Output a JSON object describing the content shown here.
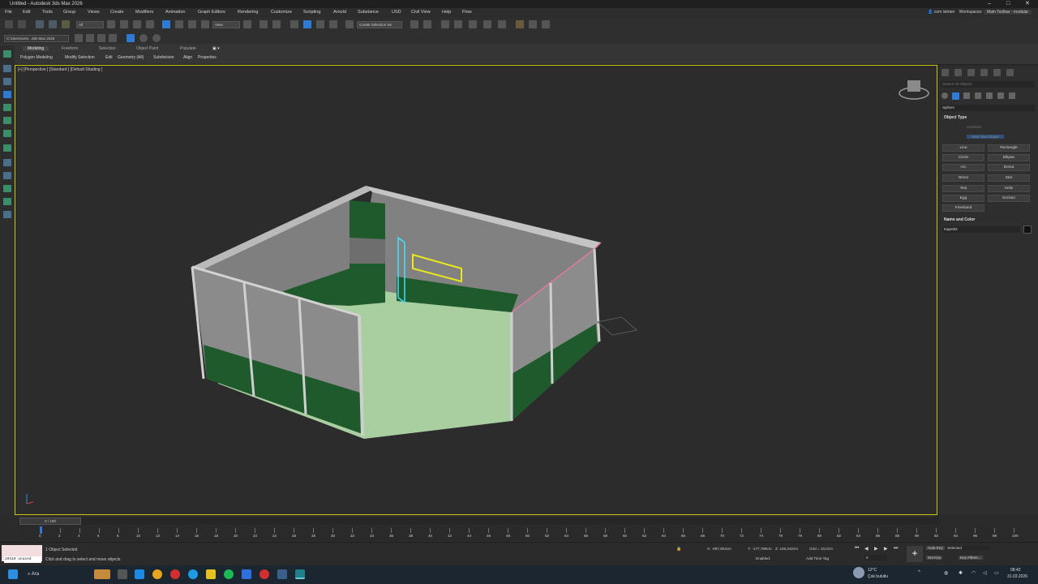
{
  "window": {
    "title": "Untitled - Autodesk 3ds Max 2026",
    "min": "–",
    "max": "□",
    "close": "✕"
  },
  "menu": [
    "File",
    "Edit",
    "Tools",
    "Group",
    "Views",
    "Create",
    "Modifiers",
    "Animation",
    "Graph Editors",
    "Rendering",
    "Customize",
    "Scripting",
    "Arnold",
    "Substance",
    "USD",
    "Civil View",
    "Help",
    "Flow"
  ],
  "user": {
    "name": "cem isimen",
    "workspaces_label": "Workspaces:",
    "workspace": "Main Toolbar - modular"
  },
  "toolbar": {
    "filter": "All",
    "ref_coord": "View",
    "selection_set": "Create Selection Se"
  },
  "path": {
    "project": "C:\\Users\\cem...3ds Max 2026"
  },
  "ribbon": {
    "tabs": [
      "Modeling",
      "Freeform",
      "Selection",
      "Object Paint",
      "Populate"
    ],
    "active_tab": "Modeling",
    "items": [
      "Polygon Modeling",
      "Modify Selection",
      "Edit",
      "Geometry (All)",
      "Subdivision",
      "Align",
      "Properties"
    ]
  },
  "viewport": {
    "label": "[+] [Perspective ] [Standard ] [Default Shading ]"
  },
  "command_panel": {
    "search_placeholder": "Search All Objects",
    "category": "Splines",
    "object_type_header": "Object Type",
    "autogrid": "AutoGrid",
    "start_new_shape": "Start New Shape",
    "buttons": [
      "Line",
      "Rectangle",
      "Circle",
      "Ellipse",
      "Arc",
      "Donut",
      "NGon",
      "Star",
      "Text",
      "Helix",
      "Egg",
      "Section",
      "Freehand"
    ],
    "name_color_header": "Name and Color",
    "object_name": "Kapı002",
    "object_color": "#111111"
  },
  "timeline": {
    "frame_display": "0 / 100",
    "ticks": [
      "0",
      "2",
      "4",
      "6",
      "8",
      "10",
      "12",
      "14",
      "16",
      "18",
      "20",
      "22",
      "24",
      "26",
      "28",
      "30",
      "32",
      "34",
      "36",
      "38",
      "40",
      "42",
      "44",
      "46",
      "48",
      "50",
      "52",
      "54",
      "56",
      "58",
      "60",
      "62",
      "64",
      "66",
      "68",
      "70",
      "72",
      "74",
      "76",
      "78",
      "80",
      "82",
      "84",
      "86",
      "88",
      "90",
      "92",
      "94",
      "96",
      "98",
      "100"
    ]
  },
  "status": {
    "maxscript_output": "20410 unused",
    "selection_info": "1 Object Selected",
    "prompt": "Click and drag to select and move objects",
    "x": "-697,903cm",
    "y": "-177,789cm",
    "z": "106,242cm",
    "grid": "Grid = 10,0cm",
    "enabled_label": "Enabled:",
    "add_time_tag": "Add Time Tag",
    "auto_key": "Auto Key",
    "set_key": "Set Key",
    "selected": "Selected",
    "key_filters": "Key Filters...",
    "frame": "0"
  },
  "taskbar": {
    "search": "Ara",
    "weather_temp": "12°C",
    "weather_desc": "Çok bulutlu",
    "time": "08:42",
    "date": "31.03.2026"
  },
  "colors": {
    "accent_blue": "#2e7bd6",
    "viewport_border": "#c7c71a",
    "wall_green": "#1f5a2c",
    "floor": "#a9cfa0"
  }
}
